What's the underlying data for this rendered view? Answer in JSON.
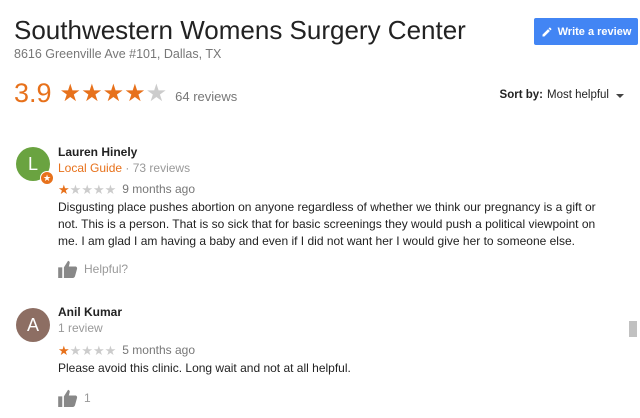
{
  "header": {
    "title": "Southwestern Womens Surgery Center",
    "address": "8616 Greenville Ave #101, Dallas, TX",
    "write_review_label": "Write a review"
  },
  "summary": {
    "rating": "3.9",
    "rating_value": 3.9,
    "stars_filled": 4,
    "stars_total": 5,
    "review_count": "64 reviews"
  },
  "sort": {
    "label": "Sort by:",
    "value": "Most helpful"
  },
  "reviews": [
    {
      "initial": "L",
      "avatar_color": "#6aa340",
      "name": "Lauren Hinely",
      "local_guide": "Local Guide",
      "separator": "·",
      "reviews_count": "73 reviews",
      "stars": 1,
      "time": "9 months ago",
      "text": "Disgusting place pushes abortion on anyone regardless of whether we think our pregnancy is a gift or not. This is a person. That is so sick that for basic screenings they would push a political viewpoint on me. I am glad I am having a baby and even if I did not want her I would give her to someone else.",
      "helpful": "Helpful?"
    },
    {
      "initial": "A",
      "avatar_color": "#8d6e63",
      "name": "Anil Kumar",
      "reviews_count": "1 review",
      "stars": 1,
      "time": "5 months ago",
      "text": "Please avoid this clinic. Long wait and not at all helpful.",
      "helpful": "1"
    }
  ],
  "colors": {
    "accent": "#e7711b",
    "button": "#4285f4"
  }
}
